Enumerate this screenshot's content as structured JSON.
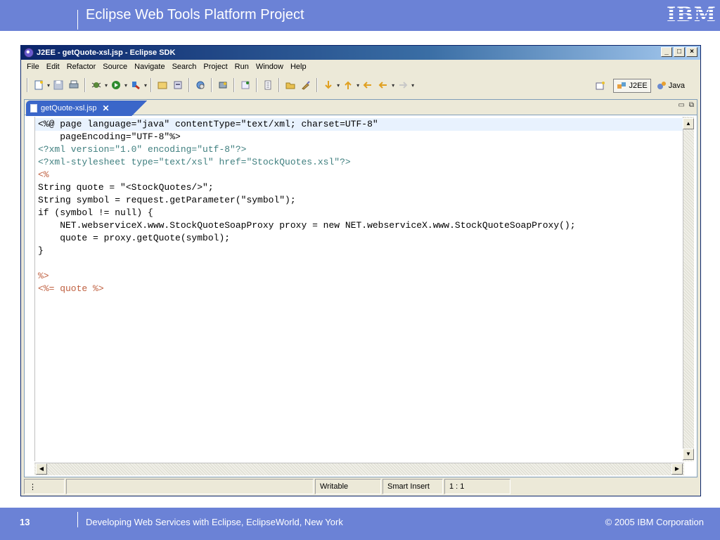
{
  "slide": {
    "header_title": "Eclipse Web Tools Platform Project",
    "logo_text": "IBM",
    "page_number": "13",
    "footer_caption": "Developing Web Services with Eclipse, EclipseWorld, New York",
    "copyright": "© 2005 IBM Corporation"
  },
  "window": {
    "title": "J2EE - getQuote-xsl.jsp - Eclipse SDK",
    "controls": {
      "minimize": "_",
      "maximize": "□",
      "close": "×"
    }
  },
  "menus": [
    "File",
    "Edit",
    "Refactor",
    "Source",
    "Navigate",
    "Search",
    "Project",
    "Run",
    "Window",
    "Help"
  ],
  "perspectives": [
    {
      "label": "J2EE",
      "active": true
    },
    {
      "label": "Java",
      "active": false
    }
  ],
  "editor": {
    "tab_label": "getQuote-xsl.jsp",
    "tab_close": "✕",
    "lines": [
      "<%@ page language=\"java\" contentType=\"text/xml; charset=UTF-8\"",
      "    pageEncoding=\"UTF-8\"%>",
      "<?xml version=\"1.0\" encoding=\"utf-8\"?>",
      "<?xml-stylesheet type=\"text/xsl\" href=\"StockQuotes.xsl\"?>",
      "<%",
      "String quote = \"<StockQuotes/>\";",
      "String symbol = request.getParameter(\"symbol\");",
      "if (symbol != null) {",
      "    NET.webserviceX.www.StockQuoteSoapProxy proxy = new NET.webserviceX.www.StockQuoteSoapProxy();",
      "    quote = proxy.getQuote(symbol);",
      "}",
      "",
      "%>",
      "<%= quote %>"
    ]
  },
  "status": {
    "writable": "Writable",
    "insert_mode": "Smart Insert",
    "position": "1 : 1"
  }
}
